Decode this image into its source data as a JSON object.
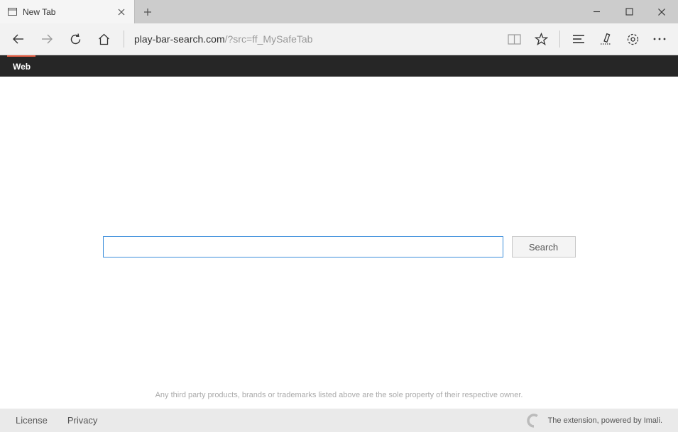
{
  "titlebar": {
    "tab_title": "New Tab"
  },
  "toolbar": {
    "url_host": "play-bar-search.com",
    "url_path": "/?src=ff_MySafeTab"
  },
  "darkbar": {
    "web_label": "Web"
  },
  "search": {
    "value": "",
    "placeholder": "",
    "button_label": "Search"
  },
  "disclaimer": "Any third party products, brands or trademarks listed above are the sole property of their respective owner.",
  "footer": {
    "license": "License",
    "privacy": "Privacy",
    "powered": "The extension, powered by Imali."
  }
}
